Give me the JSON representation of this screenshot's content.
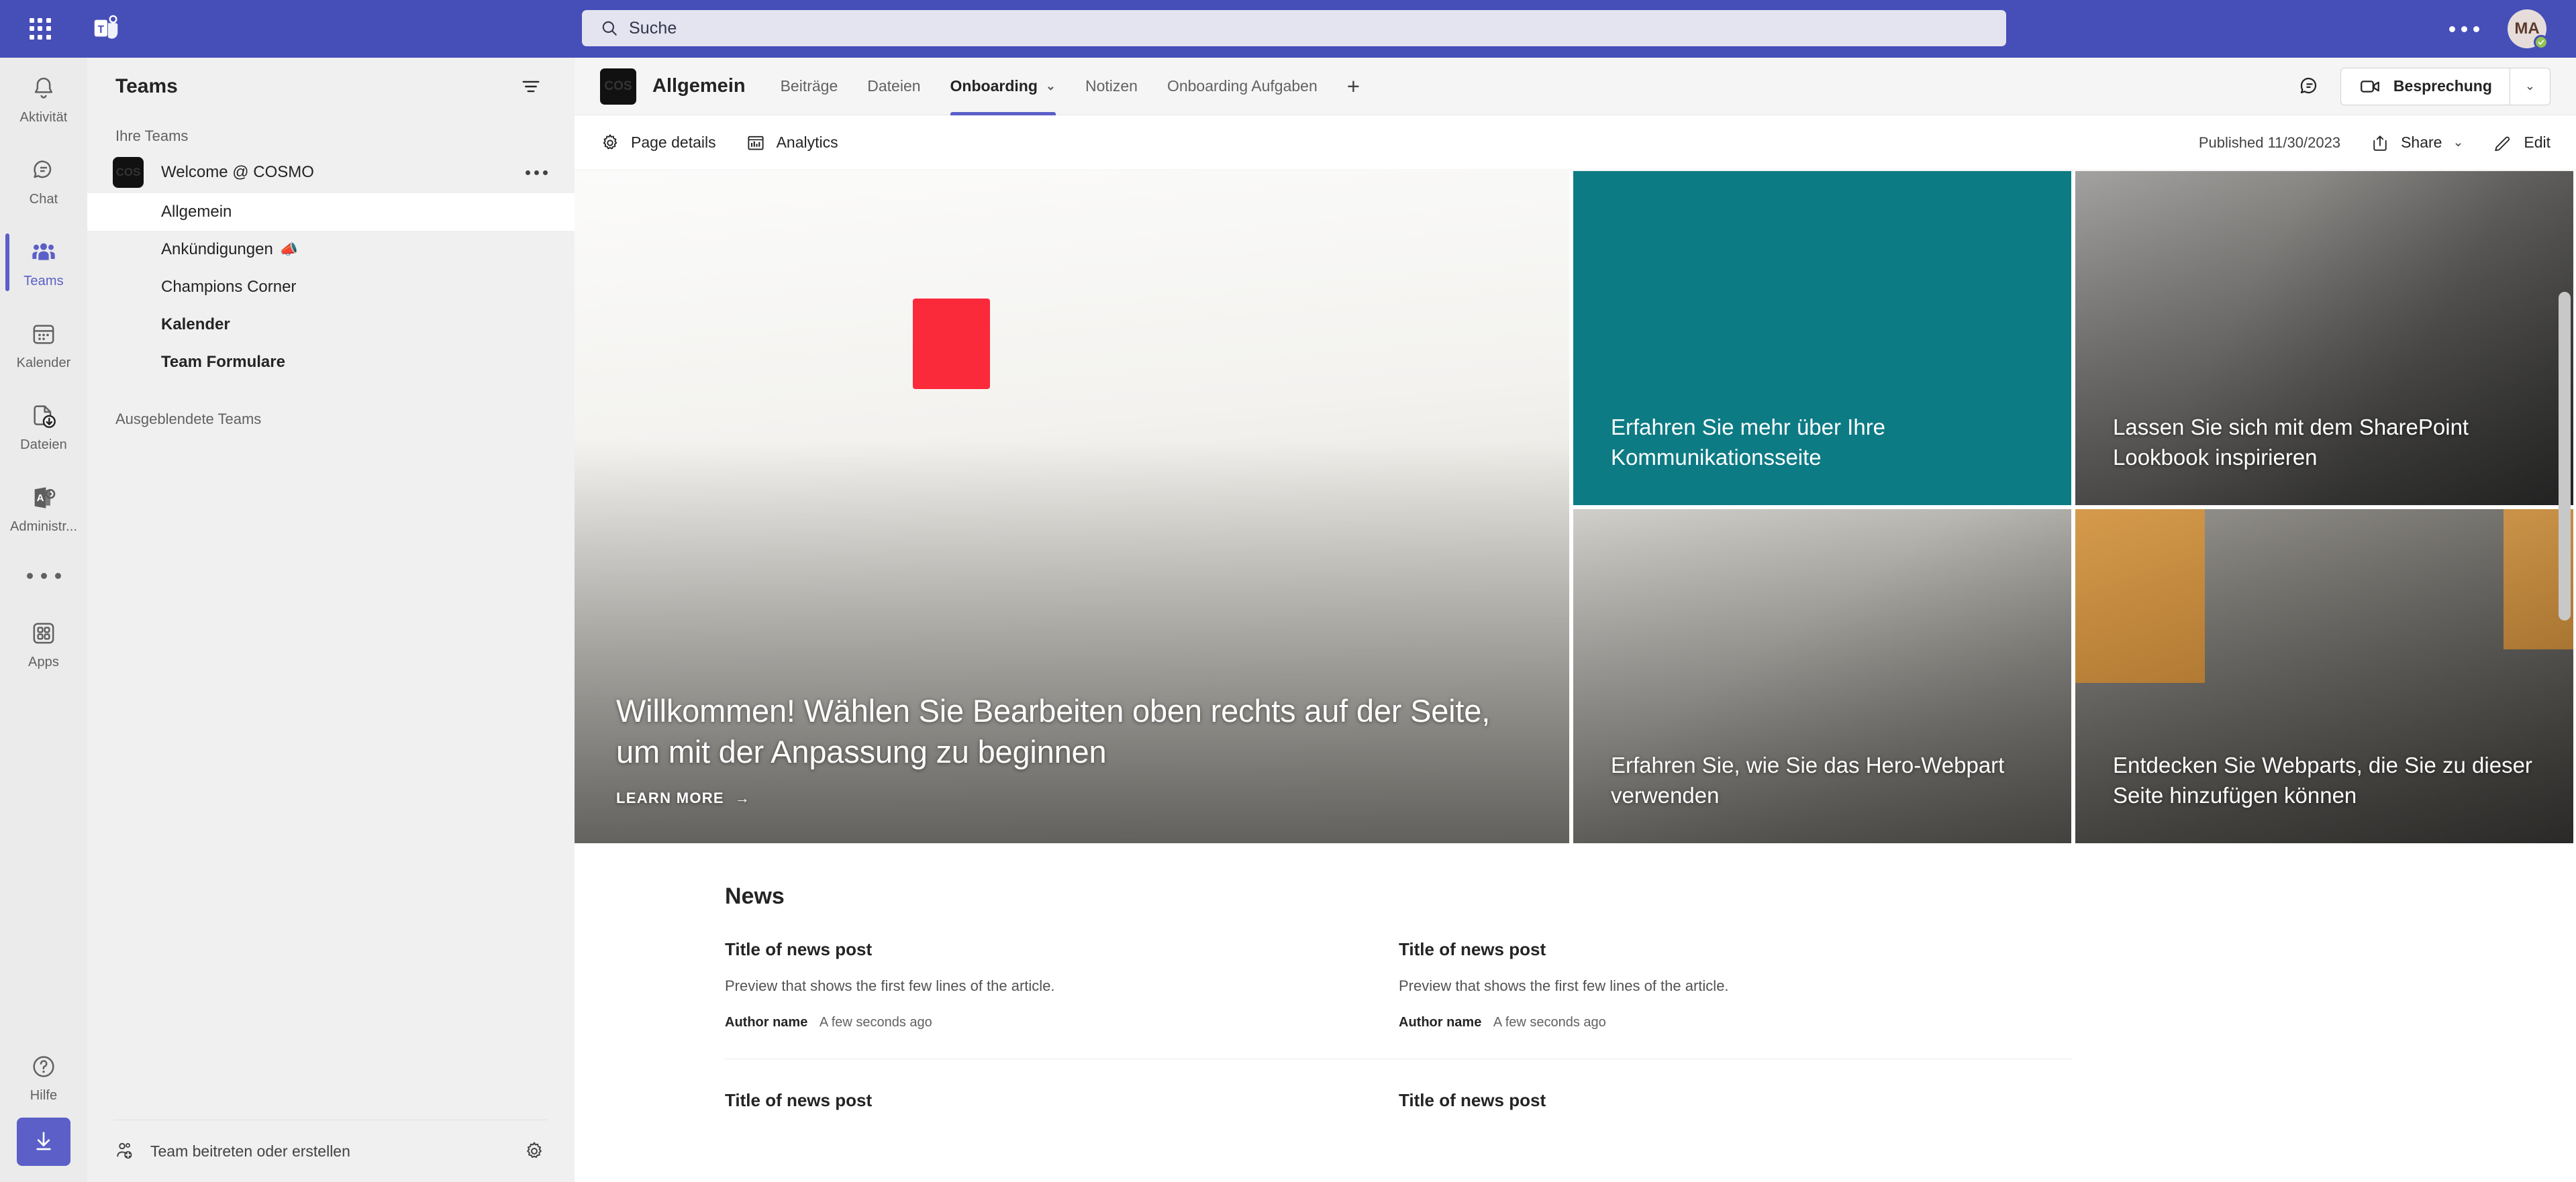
{
  "topbar": {
    "waffle_icon": "app-launcher-icon",
    "logo_icon": "teams-logo-icon",
    "search": {
      "placeholder": "Suche",
      "icon": "search-icon",
      "value": ""
    },
    "more_icon": "more-options-icon",
    "avatar": {
      "initials": "MA",
      "presence": "available"
    }
  },
  "rail": {
    "items": [
      {
        "label": "Aktivität",
        "icon": "bell-icon",
        "active": false
      },
      {
        "label": "Chat",
        "icon": "chat-icon",
        "active": false
      },
      {
        "label": "Teams",
        "icon": "teams-people-icon",
        "active": true
      },
      {
        "label": "Kalender",
        "icon": "calendar-icon",
        "active": false
      },
      {
        "label": "Dateien",
        "icon": "files-download-icon",
        "active": false
      },
      {
        "label": "Administr...",
        "icon": "admin-center-icon",
        "active": false
      }
    ],
    "more_icon": "more-apps-icon",
    "apps": {
      "label": "Apps",
      "icon": "apps-grid-icon"
    },
    "help": {
      "label": "Hilfe",
      "icon": "help-question-icon"
    },
    "download": {
      "icon": "download-arrow-icon"
    }
  },
  "sidebar": {
    "title": "Teams",
    "filter_icon": "filter-icon",
    "section_your_teams": "Ihre Teams",
    "team": {
      "name": "Welcome @ COSMO",
      "avatar_text": "COS",
      "more_icon": "team-more-options-icon"
    },
    "channels": [
      {
        "label": "Allgemein",
        "state": "selected",
        "emoji": ""
      },
      {
        "label": "Ankündigungen",
        "state": "normal",
        "emoji": "📣"
      },
      {
        "label": "Champions Corner",
        "state": "normal",
        "emoji": ""
      },
      {
        "label": "Kalender",
        "state": "unread",
        "emoji": ""
      },
      {
        "label": "Team Formulare",
        "state": "unread",
        "emoji": ""
      }
    ],
    "hidden_teams": "Ausgeblendete Teams",
    "footer": {
      "join_label": "Team beitreten oder erstellen",
      "join_icon": "add-people-icon",
      "settings_icon": "gear-icon"
    }
  },
  "channel_header": {
    "avatar_text": "COS",
    "title": "Allgemein",
    "tabs": [
      {
        "label": "Beiträge",
        "active": false,
        "has_caret": false
      },
      {
        "label": "Dateien",
        "active": false,
        "has_caret": false
      },
      {
        "label": "Onboarding",
        "active": true,
        "has_caret": true
      },
      {
        "label": "Notizen",
        "active": false,
        "has_caret": false
      },
      {
        "label": "Onboarding Aufgaben",
        "active": false,
        "has_caret": false
      }
    ],
    "add_tab_label": "+",
    "chat_icon": "conversation-icon",
    "meeting_button": {
      "label": "Besprechung",
      "icon": "video-camera-icon",
      "caret": "⌄"
    }
  },
  "command_bar": {
    "page_details": {
      "label": "Page details",
      "icon": "gear-icon"
    },
    "analytics": {
      "label": "Analytics",
      "icon": "analytics-chart-icon"
    },
    "published": "Published 11/30/2023",
    "share": {
      "label": "Share",
      "icon": "share-icon",
      "caret": "⌄"
    },
    "edit": {
      "label": "Edit",
      "icon": "pencil-icon"
    }
  },
  "hero": {
    "main": {
      "title": "Willkommen! Wählen Sie Bearbeiten oben rechts auf der Seite, um mit der Anpassung zu beginnen",
      "cta": "LEARN MORE",
      "cta_arrow": "→"
    },
    "tiles": [
      {
        "title": "Erfahren Sie mehr über Ihre Kommunikationsseite",
        "bg_color": "#0d7b84",
        "kind": "solid"
      },
      {
        "title": "Lassen Sie sich mit dem SharePoint Lookbook inspirieren",
        "kind": "photo-office-people"
      },
      {
        "title": "Erfahren Sie, wie Sie das Hero-Webpart verwenden",
        "kind": "photo-hall"
      },
      {
        "title": "Entdecken Sie Webparts, die Sie zu dieser Seite hinzufügen können",
        "kind": "photo-lounge"
      }
    ]
  },
  "news": {
    "heading": "News",
    "posts": [
      {
        "title": "Title of news post",
        "preview": "Preview that shows the first few lines of the article.",
        "author": "Author name",
        "time": "A few seconds ago"
      },
      {
        "title": "Title of news post",
        "preview": "Preview that shows the first few lines of the article.",
        "author": "Author name",
        "time": "A few seconds ago"
      }
    ],
    "row2": [
      {
        "title": "Title of news post"
      },
      {
        "title": "Title of news post"
      }
    ]
  },
  "colors": {
    "brand_purple": "#464eb8",
    "accent_purple": "#5b5fc7",
    "teal_tile": "#0d7b84",
    "presence_green": "#92c353"
  }
}
